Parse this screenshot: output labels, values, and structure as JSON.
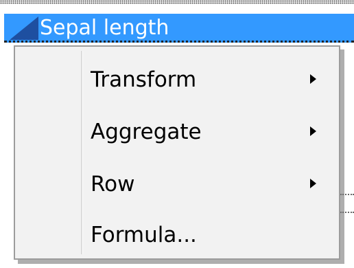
{
  "column_header": {
    "label": "Sepal length"
  },
  "context_menu": {
    "items": [
      {
        "label": "Transform",
        "has_submenu": true,
        "icon": "submenu-arrow-icon"
      },
      {
        "label": "Aggregate",
        "has_submenu": true,
        "icon": "submenu-arrow-icon"
      },
      {
        "label": "Row",
        "has_submenu": true,
        "icon": "submenu-arrow-icon"
      },
      {
        "label": "Formula...",
        "has_submenu": false
      }
    ]
  },
  "colors": {
    "header_selected": "#3399ff",
    "header_corner": "#1e4fa0",
    "menu_background": "#f2f2f2",
    "menu_border": "#9c9c9c"
  }
}
